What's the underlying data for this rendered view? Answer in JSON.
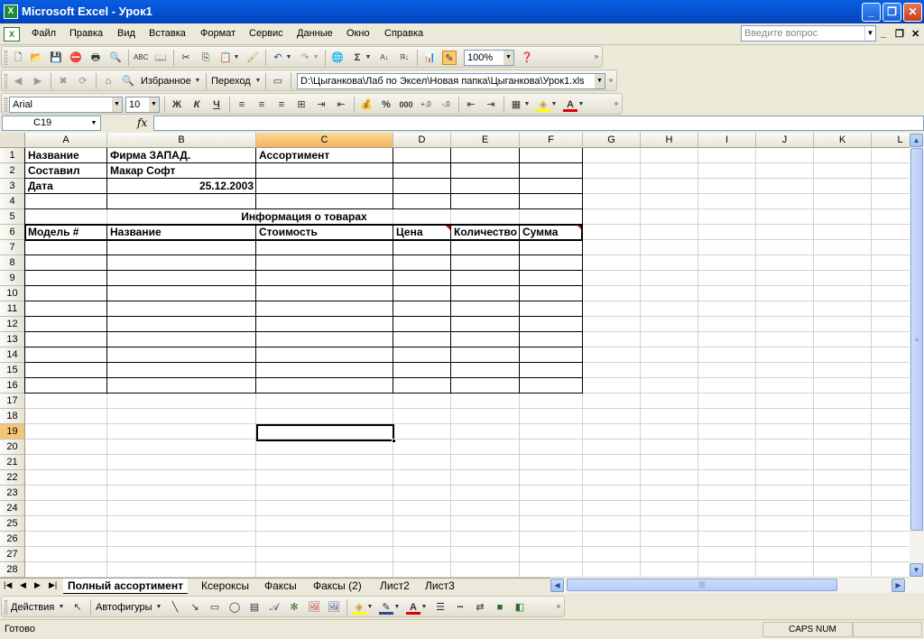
{
  "window": {
    "title": "Microsoft Excel - Урок1"
  },
  "menu": {
    "items": [
      "Файл",
      "Правка",
      "Вид",
      "Вставка",
      "Формат",
      "Сервис",
      "Данные",
      "Окно",
      "Справка"
    ],
    "help_placeholder": "Введите вопрос"
  },
  "standard_toolbar": {
    "zoom": "100%"
  },
  "web_toolbar": {
    "favorites": "Избранное",
    "goto": "Переход",
    "address": "D:\\Цыганкова\\Лаб по Эксел\\Новая папка\\Цыганкова\\Урок1.xls"
  },
  "format_toolbar": {
    "font": "Arial",
    "size": "10",
    "bold": "Ж",
    "italic": "К",
    "underline": "Ч",
    "percent": "%",
    "thousands": "000"
  },
  "formula_bar": {
    "cell_ref": "C19",
    "fx": "fx",
    "content": ""
  },
  "columns": [
    "A",
    "B",
    "C",
    "D",
    "E",
    "F",
    "G",
    "H",
    "I",
    "J",
    "K",
    "L"
  ],
  "rows": [
    "1",
    "2",
    "3",
    "4",
    "5",
    "6",
    "7",
    "8",
    "9",
    "10",
    "11",
    "12",
    "13",
    "14",
    "15",
    "16",
    "17",
    "18",
    "19",
    "20",
    "21",
    "22",
    "23",
    "24",
    "25",
    "26",
    "27",
    "28"
  ],
  "cells": {
    "a1": "Название",
    "b1": "Фирма ЗАПАД.",
    "c1": "Ассортимент",
    "a2": "Составил",
    "b2": "Макар Софт",
    "a3": "Дата",
    "b3": "25.12.2003",
    "title5": "Информация о товарах",
    "h_model": "Модель #",
    "h_name": "Название",
    "h_cost": "Стоимость",
    "h_price": "Цена",
    "h_qty": "Количество",
    "h_sum": "Сумма"
  },
  "sheets": [
    "Полный ассортимент",
    "Ксероксы",
    "Факсы",
    "Факсы (2)",
    "Лист2",
    "Лист3"
  ],
  "drawing_toolbar": {
    "actions": "Действия",
    "autoshapes": "Автофигуры"
  },
  "status": {
    "ready": "Готово",
    "caps_num": "CAPS NUM"
  }
}
